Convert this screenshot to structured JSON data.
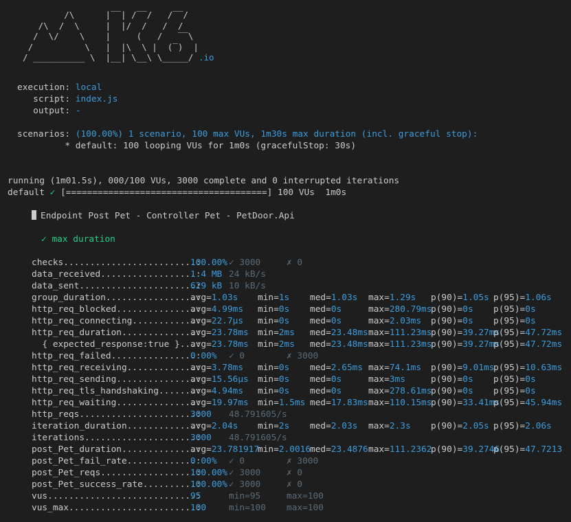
{
  "logo": {
    "art": [
      "          /\\      |‾‾| /‾‾/   /‾‾/",
      "     /\\  /  \\     |  |/  /   /  /",
      "    /  \\/    \\    |     (   /   ‾‾\\",
      "   /          \\   |  |\\  \\ |  (‾)  |",
      "  / __________ \\  |__| \\__\\ \\_____/"
    ],
    "suffix": ".io"
  },
  "execution": {
    "execution_label": "execution:",
    "execution_value": "local",
    "script_label": "script:",
    "script_value": "index.js",
    "output_label": "output:",
    "output_value": "-"
  },
  "scenarios": {
    "label": "scenarios:",
    "summary": "(100.00%) 1 scenario, 100 max VUs, 1m30s max duration (incl. graceful stop):",
    "detail": "* default: 100 looping VUs for 1m0s (gracefulStop: 30s)"
  },
  "run": {
    "status": "running (1m01.5s), 000/100 VUs, 3000 complete and 0 interrupted iterations",
    "scenario": "default",
    "check_glyph": "✓",
    "progress": "[======================================]",
    "progress_fraction": 1.0,
    "vus": "100 VUs",
    "duration": "1m0s"
  },
  "group": {
    "title": "Endpoint Post Pet - Controller Pet - PetDoor.Api",
    "check_glyph": "✓",
    "check_label": "max duration"
  },
  "metrics": [
    {
      "name": "checks.........................:",
      "c1": "100.00%",
      "c2": "✓ 3000",
      "c3": "",
      "c4": "✗ 0",
      "c5": "",
      "c6": "",
      "c7": "",
      "c8": ""
    },
    {
      "name": "data_received..................:",
      "c1": "1.4 MB",
      "c2": "24 kB/s",
      "c3": "",
      "c4": "",
      "c5": "",
      "c6": "",
      "c7": "",
      "c8": ""
    },
    {
      "name": "data_sent......................:",
      "c1": "629 kB",
      "c2": "10 kB/s",
      "c3": "",
      "c4": "",
      "c5": "",
      "c6": "",
      "c7": "",
      "c8": ""
    },
    {
      "name": "group_duration.................:",
      "c1": "avg=1.03s",
      "c2": "",
      "c3": "min=1s",
      "c4": "",
      "c5": "med=1.03s",
      "c6": "max=1.29s",
      "c7": "p(90)=1.05s",
      "c8": "p(95)=1.06s"
    },
    {
      "name": "http_req_blocked...............:",
      "c1": "avg=4.99ms",
      "c2": "",
      "c3": "min=0s",
      "c4": "",
      "c5": "med=0s",
      "c6": "max=280.79ms",
      "c7": "p(90)=0s",
      "c8": "p(95)=0s"
    },
    {
      "name": "http_req_connecting............:",
      "c1": "avg=22.7µs",
      "c2": "",
      "c3": "min=0s",
      "c4": "",
      "c5": "med=0s",
      "c6": "max=2.03ms",
      "c7": "p(90)=0s",
      "c8": "p(95)=0s"
    },
    {
      "name": "http_req_duration..............:",
      "c1": "avg=23.78ms",
      "c2": "",
      "c3": "min=2ms",
      "c4": "",
      "c5": "med=23.48ms",
      "c6": "max=111.23ms",
      "c7": "p(90)=39.27ms",
      "c8": "p(95)=47.72ms"
    },
    {
      "name": "  { expected_response:true }...:",
      "c1": "avg=23.78ms",
      "c2": "",
      "c3": "min=2ms",
      "c4": "",
      "c5": "med=23.48ms",
      "c6": "max=111.23ms",
      "c7": "p(90)=39.27ms",
      "c8": "p(95)=47.72ms"
    },
    {
      "name": "http_req_failed................:",
      "c1": "0.00%",
      "c2": "✓ 0",
      "c3": "",
      "c4": "✗ 3000",
      "c5": "",
      "c6": "",
      "c7": "",
      "c8": ""
    },
    {
      "name": "http_req_receiving.............:",
      "c1": "avg=3.78ms",
      "c2": "",
      "c3": "min=0s",
      "c4": "",
      "c5": "med=2.65ms",
      "c6": "max=74.1ms",
      "c7": "p(90)=9.01ms",
      "c8": "p(95)=10.63ms"
    },
    {
      "name": "http_req_sending...............:",
      "c1": "avg=15.56µs",
      "c2": "",
      "c3": "min=0s",
      "c4": "",
      "c5": "med=0s",
      "c6": "max=3ms",
      "c7": "p(90)=0s",
      "c8": "p(95)=0s"
    },
    {
      "name": "http_req_tls_handshaking.......:",
      "c1": "avg=4.94ms",
      "c2": "",
      "c3": "min=0s",
      "c4": "",
      "c5": "med=0s",
      "c6": "max=278.61ms",
      "c7": "p(90)=0s",
      "c8": "p(95)=0s"
    },
    {
      "name": "http_req_waiting...............:",
      "c1": "avg=19.97ms",
      "c2": "",
      "c3": "min=1.5ms",
      "c4": "",
      "c5": "med=17.83ms",
      "c6": "max=110.15ms",
      "c7": "p(90)=33.41ms",
      "c8": "p(95)=45.94ms"
    },
    {
      "name": "http_reqs......................:",
      "c1": "3000",
      "c2": "48.791605/s",
      "c3": "",
      "c4": "",
      "c5": "",
      "c6": "",
      "c7": "",
      "c8": ""
    },
    {
      "name": "iteration_duration.............:",
      "c1": "avg=2.04s",
      "c2": "",
      "c3": "min=2s",
      "c4": "",
      "c5": "med=2.03s",
      "c6": "max=2.3s",
      "c7": "p(90)=2.05s",
      "c8": "p(95)=2.06s"
    },
    {
      "name": "iterations.....................:",
      "c1": "3000",
      "c2": "48.791605/s",
      "c3": "",
      "c4": "",
      "c5": "",
      "c6": "",
      "c7": "",
      "c8": ""
    },
    {
      "name": "post_Pet_duration..............:",
      "c1": "avg=23.781917",
      "c2": "",
      "c3": "min=2.0016",
      "c4": "",
      "c5": "med=23.4876",
      "c6": "max=111.2362",
      "c7": "p(90)=39.2746",
      "c8": "p(95)=47.7213"
    },
    {
      "name": "post_Pet_fail_rate.............:",
      "c1": "0.00%",
      "c2": "✓ 0",
      "c3": "",
      "c4": "✗ 3000",
      "c5": "",
      "c6": "",
      "c7": "",
      "c8": ""
    },
    {
      "name": "post_Pet_reqs..................:",
      "c1": "100.00%",
      "c2": "✓ 3000",
      "c3": "",
      "c4": "✗ 0",
      "c5": "",
      "c6": "",
      "c7": "",
      "c8": ""
    },
    {
      "name": "post_Pet_success_rate..........:",
      "c1": "100.00%",
      "c2": "✓ 3000",
      "c3": "",
      "c4": "✗ 0",
      "c5": "",
      "c6": "",
      "c7": "",
      "c8": ""
    },
    {
      "name": "vus............................:",
      "c1": "95",
      "c2": "min=95",
      "c3": "",
      "c4": "max=100",
      "c5": "",
      "c6": "",
      "c7": "",
      "c8": ""
    },
    {
      "name": "vus_max........................:",
      "c1": "100",
      "c2": "min=100",
      "c3": "",
      "c4": "max=100",
      "c5": "",
      "c6": "",
      "c7": "",
      "c8": ""
    }
  ],
  "colors": {
    "background": "#1e1e1e",
    "text": "#cccccc",
    "value_blue": "#3b9ddd",
    "check_green": "#23d18b",
    "dim": "#5a6b78"
  }
}
